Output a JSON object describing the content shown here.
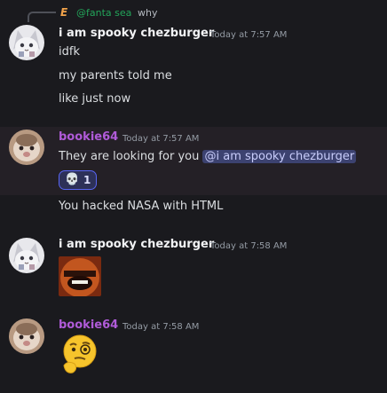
{
  "reply": {
    "icon_glyph": "E",
    "mention": "@fanta sea",
    "text": "why"
  },
  "messages": [
    {
      "author": "i am spooky chezburger",
      "timestamp": "Today at 7:57 AM",
      "lines": [
        "idfk",
        "my parents told me",
        "like just now"
      ]
    },
    {
      "author": "bookie64",
      "timestamp": "Today at 7:57 AM",
      "text": "They are looking for you",
      "mention": "@i am spooky chezburger",
      "reaction": {
        "emoji": "skull",
        "count": "1"
      },
      "followup": "You hacked NASA with HTML"
    },
    {
      "author": "i am spooky chezburger",
      "timestamp": "Today at 7:58 AM",
      "attachment": "image"
    },
    {
      "author": "bookie64",
      "timestamp": "Today at 7:58 AM",
      "attachment": "thinking-emoji"
    }
  ],
  "colors": {
    "background": "#1a1a1e",
    "highlight_background": "#242026",
    "username_default": "#f2f3f5",
    "username_bookie": "#b05bd9",
    "mention_text": "#c9cdfb",
    "mention_bg": "#3c4270",
    "reply_mention": "#23a55a"
  }
}
